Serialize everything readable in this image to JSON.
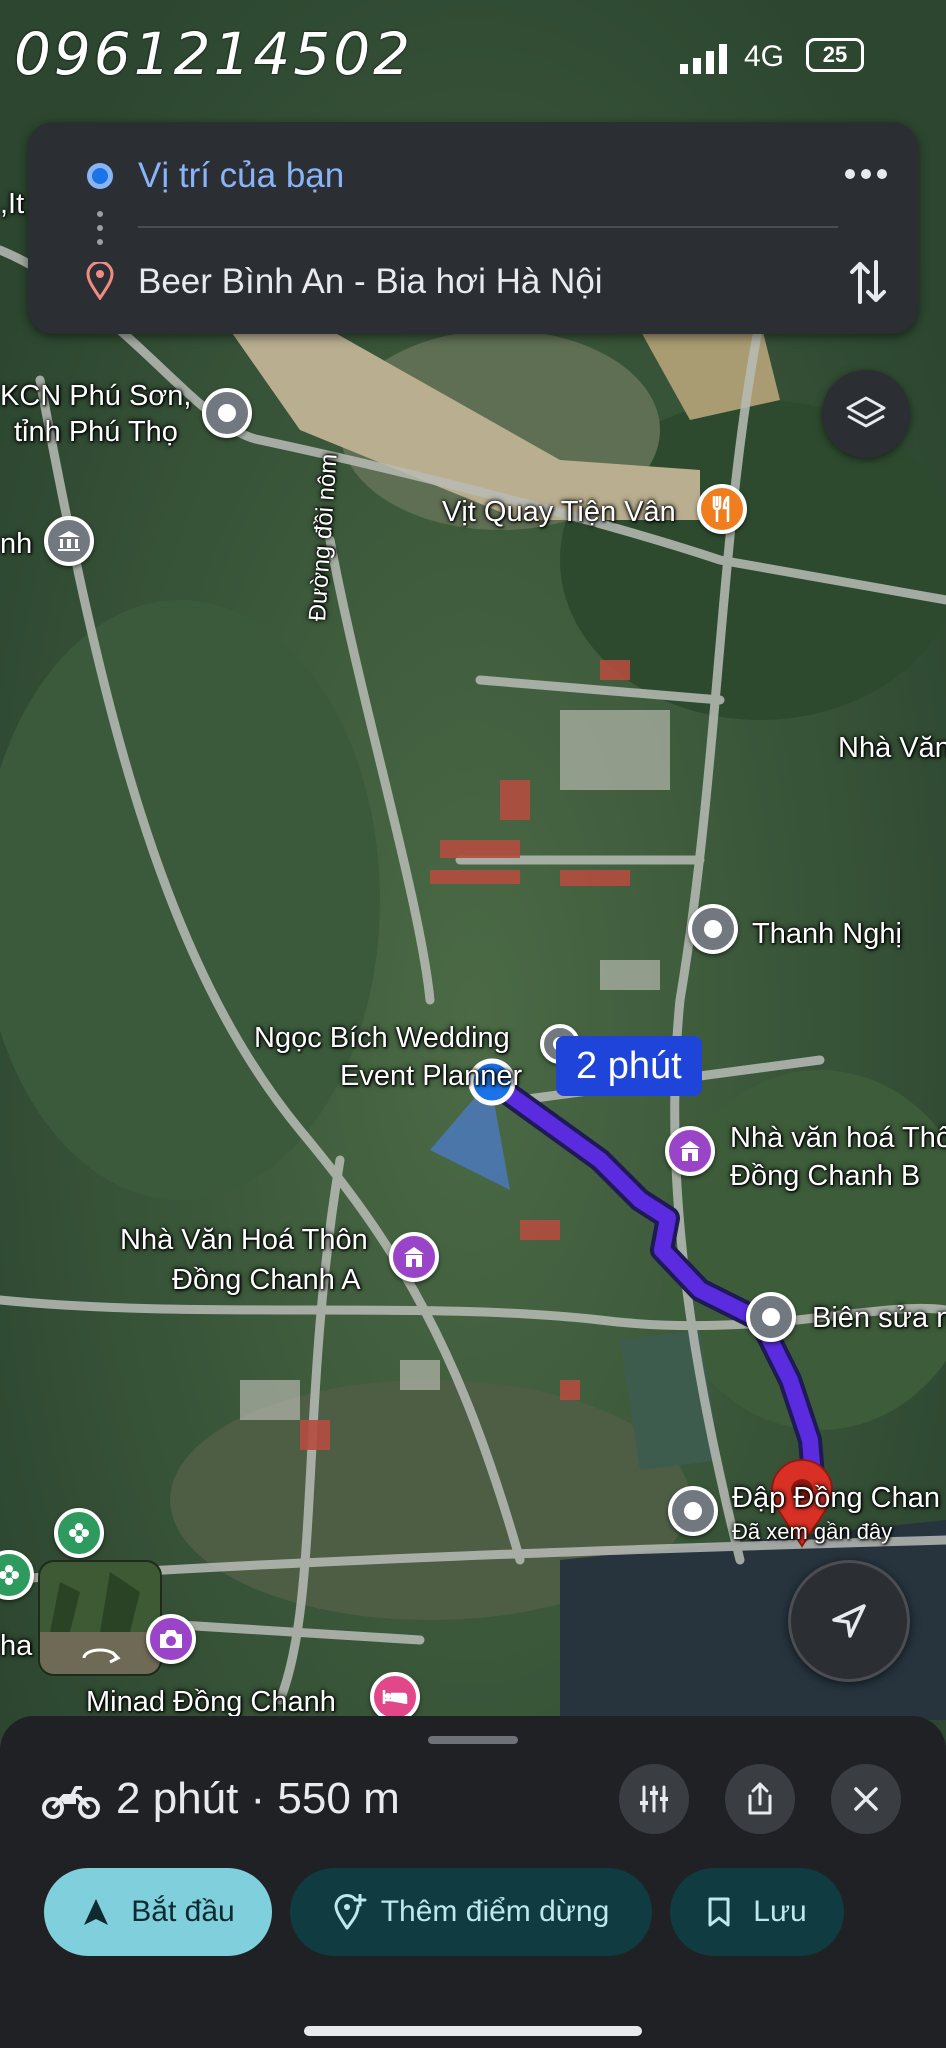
{
  "status_bar": {
    "phone_overlay": "0961214502",
    "network": "4G",
    "battery": "25"
  },
  "directions": {
    "origin": "Vị trí của bạn",
    "destination": "Beer Bình An - Bia hơi Hà Nội"
  },
  "map": {
    "labels": {
      "left_cut": ",It",
      "kcn": "KCN Phú Sơn,",
      "kcn2": "tỉnh Phú Thọ",
      "nh": "nh",
      "vit_quay": "Vịt Quay Tiện Vân",
      "road": "Đường đồi nôm",
      "nha_van_right": "Nhà Văn",
      "thanh_nghi": "Thanh Nghị",
      "ngoc_bich": "Ngọc Bích Wedding",
      "event_planner": "Event Planner",
      "nvh_b1": "Nhà văn hoá Thô",
      "nvh_b2": "Đồng Chanh B",
      "nvh_a1": "Nhà Văn Hoá Thôn",
      "nvh_a2": "Đồng Chanh A",
      "bien_sua": "Biên sửa n",
      "dap": "Đập Đồng Chan",
      "dap_sub": "Đã xem gần đây",
      "ha": "ha",
      "minad": "Minad Đồng Chanh"
    },
    "route_badge": "2 phút",
    "route_color": "#5b2be0",
    "user_dot_color": "#1a73e8"
  },
  "bottom_sheet": {
    "summary": "2 phút · 550 m",
    "start_label": "Bắt đầu",
    "add_stop_label": "Thêm điểm dừng",
    "save_label": "Lưu"
  }
}
